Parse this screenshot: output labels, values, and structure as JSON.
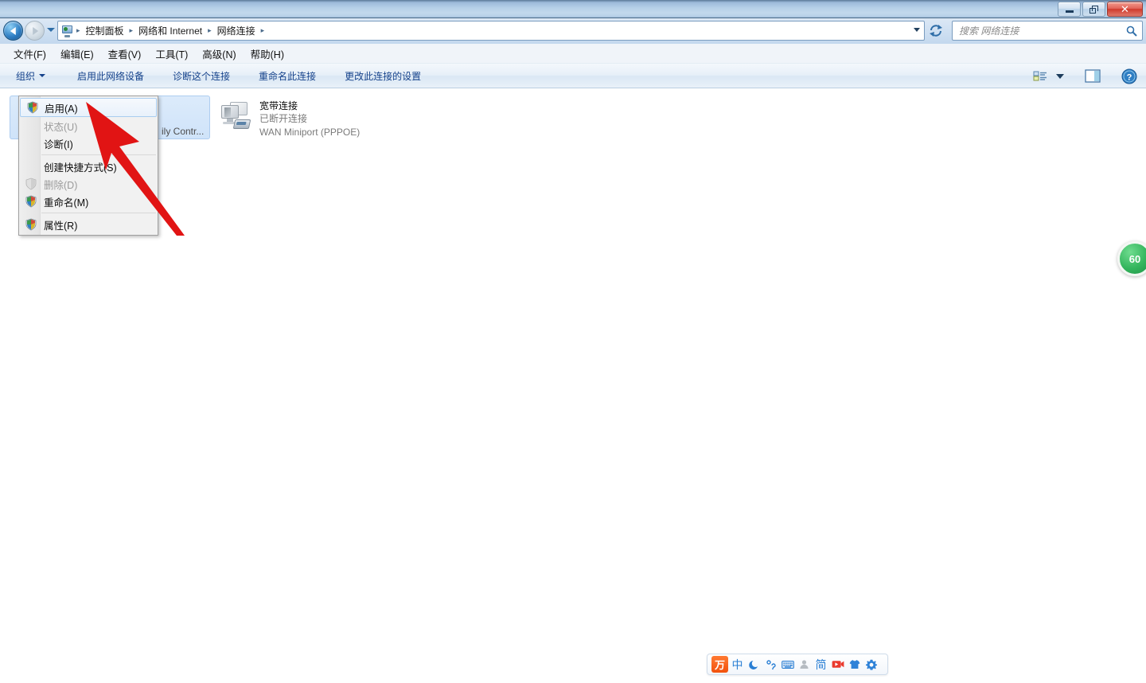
{
  "window": {
    "title": "",
    "buttons": {
      "minimize": "minimize",
      "restore": "restore",
      "close": "close"
    }
  },
  "address_bar": {
    "back": "back-button",
    "forward": "forward-button",
    "history_dropdown": "history-dropdown",
    "breadcrumbs": [
      {
        "label": "控制面板"
      },
      {
        "label": "网络和 Internet"
      },
      {
        "label": "网络连接"
      }
    ],
    "separator": "▸",
    "dropdown": "address-dropdown",
    "refresh": "refresh-button"
  },
  "search": {
    "placeholder": "搜索 网络连接",
    "value": "",
    "icon": "search-icon"
  },
  "menubar": {
    "items": [
      {
        "label": "文件(F)"
      },
      {
        "label": "编辑(E)"
      },
      {
        "label": "查看(V)"
      },
      {
        "label": "工具(T)"
      },
      {
        "label": "高级(N)"
      },
      {
        "label": "帮助(H)"
      }
    ]
  },
  "toolbar": {
    "organize": "组织",
    "items": [
      {
        "label": "启用此网络设备"
      },
      {
        "label": "诊断这个连接"
      },
      {
        "label": "重命名此连接"
      },
      {
        "label": "更改此连接的设置"
      }
    ],
    "right_icons": [
      {
        "name": "view-layout-icon"
      },
      {
        "name": "view-dropdown-icon"
      },
      {
        "name": "preview-pane-icon"
      },
      {
        "name": "help-icon"
      }
    ]
  },
  "connections": [
    {
      "name": "",
      "status": "",
      "device": "ily Contr...",
      "selected": true,
      "icon": "network-computer-icon"
    },
    {
      "name": "宽带连接",
      "status": "已断开连接",
      "device": "WAN Miniport (PPPOE)",
      "selected": false,
      "icon": "network-computer-icon"
    }
  ],
  "context_menu": {
    "items": [
      {
        "label": "启用(A)",
        "disabled": false,
        "highlighted": true,
        "shield": "uac-shield"
      },
      {
        "label": "状态(U)",
        "disabled": true,
        "highlighted": false,
        "shield": ""
      },
      {
        "label": "诊断(I)",
        "disabled": false,
        "highlighted": false,
        "shield": ""
      },
      {
        "separator": true
      },
      {
        "label": "创建快捷方式(S)",
        "disabled": false,
        "highlighted": false,
        "shield": ""
      },
      {
        "label": "删除(D)",
        "disabled": true,
        "highlighted": false,
        "shield": "uac-shield-disabled"
      },
      {
        "label": "重命名(M)",
        "disabled": false,
        "highlighted": false,
        "shield": "uac-shield"
      },
      {
        "separator": true
      },
      {
        "label": "属性(R)",
        "disabled": false,
        "highlighted": false,
        "shield": "uac-shield"
      }
    ]
  },
  "annotation": {
    "arrow": "red-arrow-pointer",
    "color": "#e11414"
  },
  "badge": {
    "text": "60",
    "color": "#2fae57"
  },
  "ime_toolbar": {
    "logo": "万",
    "items": [
      {
        "name": "ime-logo",
        "glyph": "万"
      },
      {
        "name": "ime-chinese-mode",
        "glyph": "中"
      },
      {
        "name": "ime-moon-icon",
        "glyph": "☽"
      },
      {
        "name": "ime-punctuation-icon",
        "glyph": "°,"
      },
      {
        "name": "ime-keyboard-icon",
        "glyph": "⌨"
      },
      {
        "name": "ime-user-icon",
        "glyph": "👤"
      },
      {
        "name": "ime-simplified-icon",
        "glyph": "简"
      },
      {
        "name": "ime-video-icon",
        "glyph": "▶"
      },
      {
        "name": "ime-skin-icon",
        "glyph": "👕"
      },
      {
        "name": "ime-settings-icon",
        "glyph": "⚙"
      }
    ]
  },
  "colors": {
    "accent": "#15428b",
    "selection": "#cfe3f9",
    "title_bar": "#b6d0e8",
    "close_button": "#cf3a2c"
  }
}
